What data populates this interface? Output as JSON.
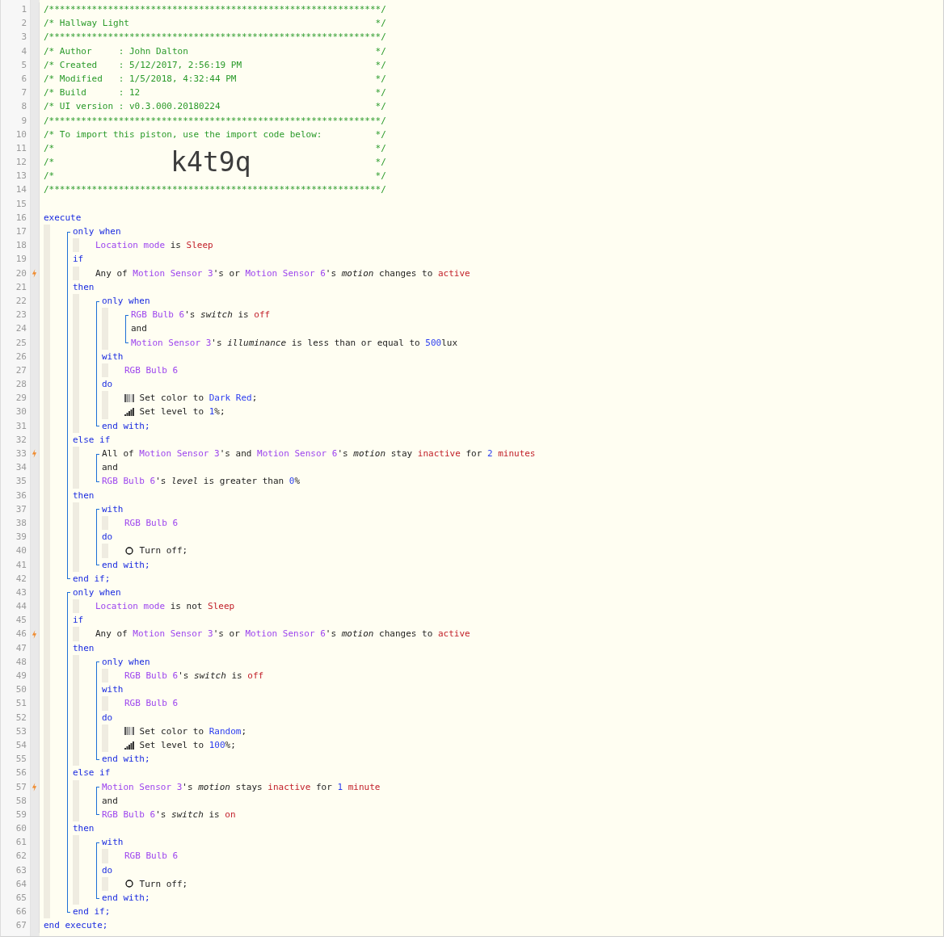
{
  "code": [
    {
      "kind": "line",
      "n": "1",
      "trigger": false,
      "tokens": [
        {
          "kind": "cm",
          "text": "/**************************************************************/"
        }
      ]
    },
    {
      "kind": "line",
      "n": "2",
      "trigger": false,
      "tokens": [
        {
          "kind": "cm",
          "text": "/* Hallway Light"
        },
        {
          "kind": "cme",
          "text": "*/"
        }
      ]
    },
    {
      "kind": "line",
      "n": "3",
      "trigger": false,
      "tokens": [
        {
          "kind": "cm",
          "text": "/**************************************************************/"
        }
      ]
    },
    {
      "kind": "line",
      "n": "4",
      "trigger": false,
      "tokens": [
        {
          "kind": "cm",
          "text": "/* Author     : John Dalton"
        },
        {
          "kind": "cme",
          "text": "*/"
        }
      ]
    },
    {
      "kind": "line",
      "n": "5",
      "trigger": false,
      "tokens": [
        {
          "kind": "cm",
          "text": "/* Created    : 5/12/2017, 2:56:19 PM"
        },
        {
          "kind": "cme",
          "text": "*/"
        }
      ]
    },
    {
      "kind": "line",
      "n": "6",
      "trigger": false,
      "tokens": [
        {
          "kind": "cm",
          "text": "/* Modified   : 1/5/2018, 4:32:44 PM"
        },
        {
          "kind": "cme",
          "text": "*/"
        }
      ]
    },
    {
      "kind": "line",
      "n": "7",
      "trigger": false,
      "tokens": [
        {
          "kind": "cm",
          "text": "/* Build      : 12"
        },
        {
          "kind": "cme",
          "text": "*/"
        }
      ]
    },
    {
      "kind": "line",
      "n": "8",
      "trigger": false,
      "tokens": [
        {
          "kind": "cm",
          "text": "/* UI version : v0.3.000.20180224"
        },
        {
          "kind": "cme",
          "text": "*/"
        }
      ]
    },
    {
      "kind": "line",
      "n": "9",
      "trigger": false,
      "tokens": [
        {
          "kind": "cm",
          "text": "/**************************************************************/"
        }
      ]
    },
    {
      "kind": "line",
      "n": "10",
      "trigger": false,
      "tokens": [
        {
          "kind": "cm",
          "text": "/* To import this piston, use the import code below:"
        },
        {
          "kind": "cme",
          "text": "*/"
        }
      ]
    },
    {
      "kind": "line",
      "n": "11",
      "trigger": false,
      "tokens": [
        {
          "kind": "cm",
          "text": "/*"
        },
        {
          "kind": "cme",
          "text": "*/"
        }
      ]
    },
    {
      "kind": "line",
      "n": "12",
      "trigger": false,
      "tokens": [
        {
          "kind": "cm",
          "text": "/*"
        },
        {
          "kind": "code",
          "text": "k4t9q"
        },
        {
          "kind": "cme",
          "text": "*/"
        }
      ]
    },
    {
      "kind": "line",
      "n": "13",
      "trigger": false,
      "tokens": [
        {
          "kind": "cm",
          "text": "/*"
        },
        {
          "kind": "cme",
          "text": "*/"
        }
      ]
    },
    {
      "kind": "line",
      "n": "14",
      "trigger": false,
      "tokens": [
        {
          "kind": "cm",
          "text": "/**************************************************************/"
        }
      ]
    },
    {
      "kind": "line",
      "n": "15",
      "trigger": false
    },
    {
      "kind": "line",
      "n": "16",
      "trigger": false,
      "tokens": [
        {
          "kind": "kw",
          "text": "execute"
        }
      ]
    },
    {
      "kind": "block",
      "children": [
        {
          "kind": "group",
          "children": [
            {
              "kind": "line",
              "n": "17",
              "trigger": false,
              "tokens": [
                {
                  "kind": "kw",
                  "text": "only when"
                }
              ]
            },
            {
              "kind": "block",
              "children": [
                {
                  "kind": "line",
                  "n": "18",
                  "trigger": false,
                  "tokens": [
                    {
                      "kind": "dev",
                      "text": "Location mode"
                    },
                    {
                      "kind": "txt",
                      "text": " is "
                    },
                    {
                      "kind": "val",
                      "text": "Sleep"
                    }
                  ]
                }
              ]
            },
            {
              "kind": "line",
              "n": "19",
              "trigger": false,
              "tokens": [
                {
                  "kind": "kw",
                  "text": "if"
                }
              ]
            },
            {
              "kind": "block",
              "children": [
                {
                  "kind": "line",
                  "n": "20",
                  "trigger": true,
                  "tokens": [
                    {
                      "kind": "txt",
                      "text": "Any of "
                    },
                    {
                      "kind": "dev",
                      "text": "Motion Sensor 3"
                    },
                    {
                      "kind": "txt",
                      "text": "'s or "
                    },
                    {
                      "kind": "dev",
                      "text": "Motion Sensor 6"
                    },
                    {
                      "kind": "txt",
                      "text": "'s "
                    },
                    {
                      "kind": "attr",
                      "text": "motion"
                    },
                    {
                      "kind": "txt",
                      "text": " changes to "
                    },
                    {
                      "kind": "val",
                      "text": "active"
                    }
                  ]
                }
              ]
            },
            {
              "kind": "line",
              "n": "21",
              "trigger": false,
              "tokens": [
                {
                  "kind": "kw",
                  "text": "then"
                }
              ]
            },
            {
              "kind": "block",
              "children": [
                {
                  "kind": "group",
                  "children": [
                    {
                      "kind": "line",
                      "n": "22",
                      "trigger": false,
                      "tokens": [
                        {
                          "kind": "kw",
                          "text": "only when"
                        }
                      ]
                    },
                    {
                      "kind": "block",
                      "children": [
                        {
                          "kind": "group",
                          "children": [
                            {
                              "kind": "line",
                              "n": "23",
                              "trigger": false,
                              "tokens": [
                                {
                                  "kind": "dev",
                                  "text": "RGB Bulb 6"
                                },
                                {
                                  "kind": "txt",
                                  "text": "'s "
                                },
                                {
                                  "kind": "attr",
                                  "text": "switch"
                                },
                                {
                                  "kind": "txt",
                                  "text": " is "
                                },
                                {
                                  "kind": "val",
                                  "text": "off"
                                }
                              ]
                            },
                            {
                              "kind": "line",
                              "n": "24",
                              "trigger": false,
                              "tokens": [
                                {
                                  "kind": "txt",
                                  "text": "and"
                                }
                              ]
                            },
                            {
                              "kind": "line",
                              "n": "25",
                              "trigger": false,
                              "tokens": [
                                {
                                  "kind": "dev",
                                  "text": "Motion Sensor 3"
                                },
                                {
                                  "kind": "txt",
                                  "text": "'s "
                                },
                                {
                                  "kind": "attr",
                                  "text": "illuminance"
                                },
                                {
                                  "kind": "txt",
                                  "text": " is less than or equal to "
                                },
                                {
                                  "kind": "num",
                                  "text": "500"
                                },
                                {
                                  "kind": "txt",
                                  "text": "lux"
                                }
                              ]
                            }
                          ]
                        }
                      ]
                    },
                    {
                      "kind": "line",
                      "n": "26",
                      "trigger": false,
                      "tokens": [
                        {
                          "kind": "kw",
                          "text": "with"
                        }
                      ]
                    },
                    {
                      "kind": "block",
                      "children": [
                        {
                          "kind": "line",
                          "n": "27",
                          "trigger": false,
                          "tokens": [
                            {
                              "kind": "dev",
                              "text": "RGB Bulb 6"
                            }
                          ]
                        }
                      ]
                    },
                    {
                      "kind": "line",
                      "n": "28",
                      "trigger": false,
                      "tokens": [
                        {
                          "kind": "kw",
                          "text": "do"
                        }
                      ]
                    },
                    {
                      "kind": "block",
                      "children": [
                        {
                          "kind": "line",
                          "n": "29",
                          "trigger": false,
                          "tokens": [
                            {
                              "kind": "swatch"
                            },
                            {
                              "kind": "txt",
                              "text": " Set color to "
                            },
                            {
                              "kind": "num",
                              "text": "Dark Red"
                            },
                            {
                              "kind": "txt",
                              "text": ";"
                            }
                          ]
                        },
                        {
                          "kind": "line",
                          "n": "30",
                          "trigger": false,
                          "tokens": [
                            {
                              "kind": "bars"
                            },
                            {
                              "kind": "txt",
                              "text": " Set level to "
                            },
                            {
                              "kind": "num",
                              "text": "1"
                            },
                            {
                              "kind": "txt",
                              "text": "%;"
                            }
                          ]
                        }
                      ]
                    },
                    {
                      "kind": "line",
                      "n": "31",
                      "trigger": false,
                      "tokens": [
                        {
                          "kind": "kw",
                          "text": "end with;"
                        }
                      ]
                    }
                  ]
                }
              ]
            },
            {
              "kind": "line",
              "n": "32",
              "trigger": false,
              "tokens": [
                {
                  "kind": "kw",
                  "text": "else if"
                }
              ]
            },
            {
              "kind": "block",
              "children": [
                {
                  "kind": "group",
                  "children": [
                    {
                      "kind": "line",
                      "n": "33",
                      "trigger": true,
                      "tokens": [
                        {
                          "kind": "txt",
                          "text": "All of "
                        },
                        {
                          "kind": "dev",
                          "text": "Motion Sensor 3"
                        },
                        {
                          "kind": "txt",
                          "text": "'s and "
                        },
                        {
                          "kind": "dev",
                          "text": "Motion Sensor 6"
                        },
                        {
                          "kind": "txt",
                          "text": "'s "
                        },
                        {
                          "kind": "attr",
                          "text": "motion"
                        },
                        {
                          "kind": "txt",
                          "text": " stay "
                        },
                        {
                          "kind": "val",
                          "text": "inactive"
                        },
                        {
                          "kind": "txt",
                          "text": " for "
                        },
                        {
                          "kind": "num",
                          "text": "2"
                        },
                        {
                          "kind": "val",
                          "text": " minutes"
                        }
                      ]
                    },
                    {
                      "kind": "line",
                      "n": "34",
                      "trigger": false,
                      "tokens": [
                        {
                          "kind": "txt",
                          "text": "and"
                        }
                      ]
                    },
                    {
                      "kind": "line",
                      "n": "35",
                      "trigger": false,
                      "tokens": [
                        {
                          "kind": "dev",
                          "text": "RGB Bulb 6"
                        },
                        {
                          "kind": "txt",
                          "text": "'s "
                        },
                        {
                          "kind": "attr",
                          "text": "level"
                        },
                        {
                          "kind": "txt",
                          "text": " is greater than "
                        },
                        {
                          "kind": "num",
                          "text": "0"
                        },
                        {
                          "kind": "txt",
                          "text": "%"
                        }
                      ]
                    }
                  ]
                }
              ]
            },
            {
              "kind": "line",
              "n": "36",
              "trigger": false,
              "tokens": [
                {
                  "kind": "kw",
                  "text": "then"
                }
              ]
            },
            {
              "kind": "block",
              "children": [
                {
                  "kind": "group",
                  "children": [
                    {
                      "kind": "line",
                      "n": "37",
                      "trigger": false,
                      "tokens": [
                        {
                          "kind": "kw",
                          "text": "with"
                        }
                      ]
                    },
                    {
                      "kind": "block",
                      "children": [
                        {
                          "kind": "line",
                          "n": "38",
                          "trigger": false,
                          "tokens": [
                            {
                              "kind": "dev",
                              "text": "RGB Bulb 6"
                            }
                          ]
                        }
                      ]
                    },
                    {
                      "kind": "line",
                      "n": "39",
                      "trigger": false,
                      "tokens": [
                        {
                          "kind": "kw",
                          "text": "do"
                        }
                      ]
                    },
                    {
                      "kind": "block",
                      "children": [
                        {
                          "kind": "line",
                          "n": "40",
                          "trigger": false,
                          "tokens": [
                            {
                              "kind": "ring"
                            },
                            {
                              "kind": "txt",
                              "text": " Turn off;"
                            }
                          ]
                        }
                      ]
                    },
                    {
                      "kind": "line",
                      "n": "41",
                      "trigger": false,
                      "tokens": [
                        {
                          "kind": "kw",
                          "text": "end with;"
                        }
                      ]
                    }
                  ]
                }
              ]
            },
            {
              "kind": "line",
              "n": "42",
              "trigger": false,
              "tokens": [
                {
                  "kind": "kw",
                  "text": "end if;"
                }
              ]
            }
          ]
        },
        {
          "kind": "group",
          "children": [
            {
              "kind": "line",
              "n": "43",
              "trigger": false,
              "tokens": [
                {
                  "kind": "kw",
                  "text": "only when"
                }
              ]
            },
            {
              "kind": "block",
              "children": [
                {
                  "kind": "line",
                  "n": "44",
                  "trigger": false,
                  "tokens": [
                    {
                      "kind": "dev",
                      "text": "Location mode"
                    },
                    {
                      "kind": "txt",
                      "text": " is not "
                    },
                    {
                      "kind": "val",
                      "text": "Sleep"
                    }
                  ]
                }
              ]
            },
            {
              "kind": "line",
              "n": "45",
              "trigger": false,
              "tokens": [
                {
                  "kind": "kw",
                  "text": "if"
                }
              ]
            },
            {
              "kind": "block",
              "children": [
                {
                  "kind": "line",
                  "n": "46",
                  "trigger": true,
                  "tokens": [
                    {
                      "kind": "txt",
                      "text": "Any of "
                    },
                    {
                      "kind": "dev",
                      "text": "Motion Sensor 3"
                    },
                    {
                      "kind": "txt",
                      "text": "'s or "
                    },
                    {
                      "kind": "dev",
                      "text": "Motion Sensor 6"
                    },
                    {
                      "kind": "txt",
                      "text": "'s "
                    },
                    {
                      "kind": "attr",
                      "text": "motion"
                    },
                    {
                      "kind": "txt",
                      "text": " changes to "
                    },
                    {
                      "kind": "val",
                      "text": "active"
                    }
                  ]
                }
              ]
            },
            {
              "kind": "line",
              "n": "47",
              "trigger": false,
              "tokens": [
                {
                  "kind": "kw",
                  "text": "then"
                }
              ]
            },
            {
              "kind": "block",
              "children": [
                {
                  "kind": "group",
                  "children": [
                    {
                      "kind": "line",
                      "n": "48",
                      "trigger": false,
                      "tokens": [
                        {
                          "kind": "kw",
                          "text": "only when"
                        }
                      ]
                    },
                    {
                      "kind": "block",
                      "children": [
                        {
                          "kind": "line",
                          "n": "49",
                          "trigger": false,
                          "tokens": [
                            {
                              "kind": "dev",
                              "text": "RGB Bulb 6"
                            },
                            {
                              "kind": "txt",
                              "text": "'s "
                            },
                            {
                              "kind": "attr",
                              "text": "switch"
                            },
                            {
                              "kind": "txt",
                              "text": " is "
                            },
                            {
                              "kind": "val",
                              "text": "off"
                            }
                          ]
                        }
                      ]
                    },
                    {
                      "kind": "line",
                      "n": "50",
                      "trigger": false,
                      "tokens": [
                        {
                          "kind": "kw",
                          "text": "with"
                        }
                      ]
                    },
                    {
                      "kind": "block",
                      "children": [
                        {
                          "kind": "line",
                          "n": "51",
                          "trigger": false,
                          "tokens": [
                            {
                              "kind": "dev",
                              "text": "RGB Bulb 6"
                            }
                          ]
                        }
                      ]
                    },
                    {
                      "kind": "line",
                      "n": "52",
                      "trigger": false,
                      "tokens": [
                        {
                          "kind": "kw",
                          "text": "do"
                        }
                      ]
                    },
                    {
                      "kind": "block",
                      "children": [
                        {
                          "kind": "line",
                          "n": "53",
                          "trigger": false,
                          "tokens": [
                            {
                              "kind": "swatch"
                            },
                            {
                              "kind": "txt",
                              "text": " Set color to "
                            },
                            {
                              "kind": "num",
                              "text": "Random"
                            },
                            {
                              "kind": "txt",
                              "text": ";"
                            }
                          ]
                        },
                        {
                          "kind": "line",
                          "n": "54",
                          "trigger": false,
                          "tokens": [
                            {
                              "kind": "bars"
                            },
                            {
                              "kind": "txt",
                              "text": " Set level to "
                            },
                            {
                              "kind": "num",
                              "text": "100"
                            },
                            {
                              "kind": "txt",
                              "text": "%;"
                            }
                          ]
                        }
                      ]
                    },
                    {
                      "kind": "line",
                      "n": "55",
                      "trigger": false,
                      "tokens": [
                        {
                          "kind": "kw",
                          "text": "end with;"
                        }
                      ]
                    }
                  ]
                }
              ]
            },
            {
              "kind": "line",
              "n": "56",
              "trigger": false,
              "tokens": [
                {
                  "kind": "kw",
                  "text": "else if"
                }
              ]
            },
            {
              "kind": "block",
              "children": [
                {
                  "kind": "group",
                  "children": [
                    {
                      "kind": "line",
                      "n": "57",
                      "trigger": true,
                      "tokens": [
                        {
                          "kind": "dev",
                          "text": "Motion Sensor 3"
                        },
                        {
                          "kind": "txt",
                          "text": "'s "
                        },
                        {
                          "kind": "attr",
                          "text": "motion"
                        },
                        {
                          "kind": "txt",
                          "text": " stays "
                        },
                        {
                          "kind": "val",
                          "text": "inactive"
                        },
                        {
                          "kind": "txt",
                          "text": " for "
                        },
                        {
                          "kind": "num",
                          "text": "1"
                        },
                        {
                          "kind": "val",
                          "text": " minute"
                        }
                      ]
                    },
                    {
                      "kind": "line",
                      "n": "58",
                      "trigger": false,
                      "tokens": [
                        {
                          "kind": "txt",
                          "text": "and"
                        }
                      ]
                    },
                    {
                      "kind": "line",
                      "n": "59",
                      "trigger": false,
                      "tokens": [
                        {
                          "kind": "dev",
                          "text": "RGB Bulb 6"
                        },
                        {
                          "kind": "txt",
                          "text": "'s "
                        },
                        {
                          "kind": "attr",
                          "text": "switch"
                        },
                        {
                          "kind": "txt",
                          "text": " is "
                        },
                        {
                          "kind": "val",
                          "text": "on"
                        }
                      ]
                    }
                  ]
                }
              ]
            },
            {
              "kind": "line",
              "n": "60",
              "trigger": false,
              "tokens": [
                {
                  "kind": "kw",
                  "text": "then"
                }
              ]
            },
            {
              "kind": "block",
              "children": [
                {
                  "kind": "group",
                  "children": [
                    {
                      "kind": "line",
                      "n": "61",
                      "trigger": false,
                      "tokens": [
                        {
                          "kind": "kw",
                          "text": "with"
                        }
                      ]
                    },
                    {
                      "kind": "block",
                      "children": [
                        {
                          "kind": "line",
                          "n": "62",
                          "trigger": false,
                          "tokens": [
                            {
                              "kind": "dev",
                              "text": "RGB Bulb 6"
                            }
                          ]
                        }
                      ]
                    },
                    {
                      "kind": "line",
                      "n": "63",
                      "trigger": false,
                      "tokens": [
                        {
                          "kind": "kw",
                          "text": "do"
                        }
                      ]
                    },
                    {
                      "kind": "block",
                      "children": [
                        {
                          "kind": "line",
                          "n": "64",
                          "trigger": false,
                          "tokens": [
                            {
                              "kind": "ring"
                            },
                            {
                              "kind": "txt",
                              "text": " Turn off;"
                            }
                          ]
                        }
                      ]
                    },
                    {
                      "kind": "line",
                      "n": "65",
                      "trigger": false,
                      "tokens": [
                        {
                          "kind": "kw",
                          "text": "end with;"
                        }
                      ]
                    }
                  ]
                }
              ]
            },
            {
              "kind": "line",
              "n": "66",
              "trigger": false,
              "tokens": [
                {
                  "kind": "kw",
                  "text": "end if;"
                }
              ]
            }
          ]
        }
      ]
    },
    {
      "kind": "line",
      "n": "67",
      "trigger": false,
      "tokens": [
        {
          "kind": "kw",
          "text": "end execute;"
        }
      ]
    }
  ]
}
